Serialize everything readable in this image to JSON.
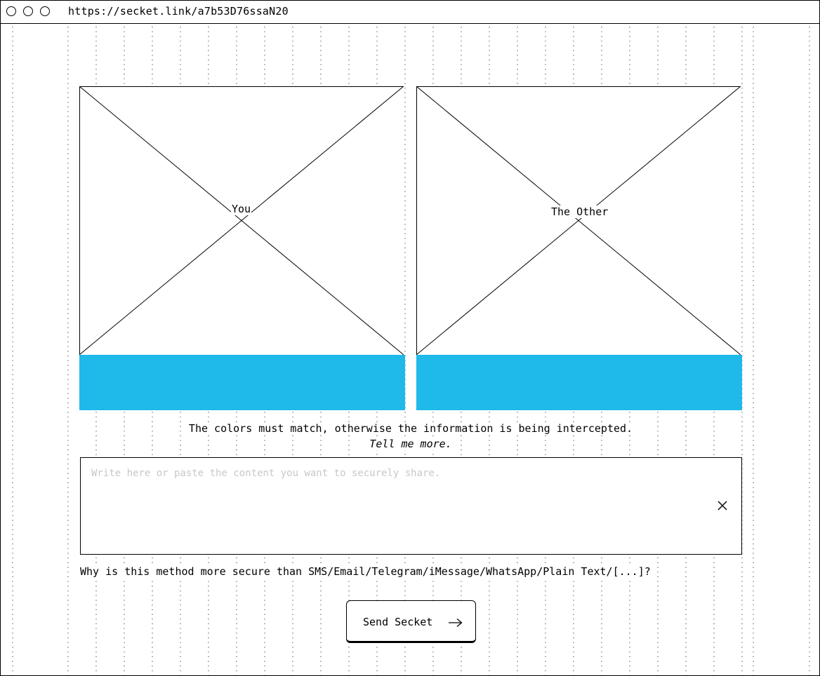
{
  "browser": {
    "url": "https://secket.link/a7b53D76ssaN20"
  },
  "panels": {
    "you": {
      "label": "You",
      "color": "#1fb9ea"
    },
    "other": {
      "label": "The Other",
      "color": "#1fb9ea"
    }
  },
  "notice": {
    "line1": "The colors must match, otherwise the information is being intercepted.",
    "link": "Tell me more."
  },
  "editor": {
    "value": "",
    "placeholder": "Write here or paste the content you want to securely share.",
    "clear_icon": "close-icon"
  },
  "why_link": "Why is this method more secure than SMS/Email/Telegram/iMessage/WhatsApp/Plain Text/[...]?",
  "send_button": {
    "label": "Send Secket",
    "icon": "arrow-right-icon"
  }
}
